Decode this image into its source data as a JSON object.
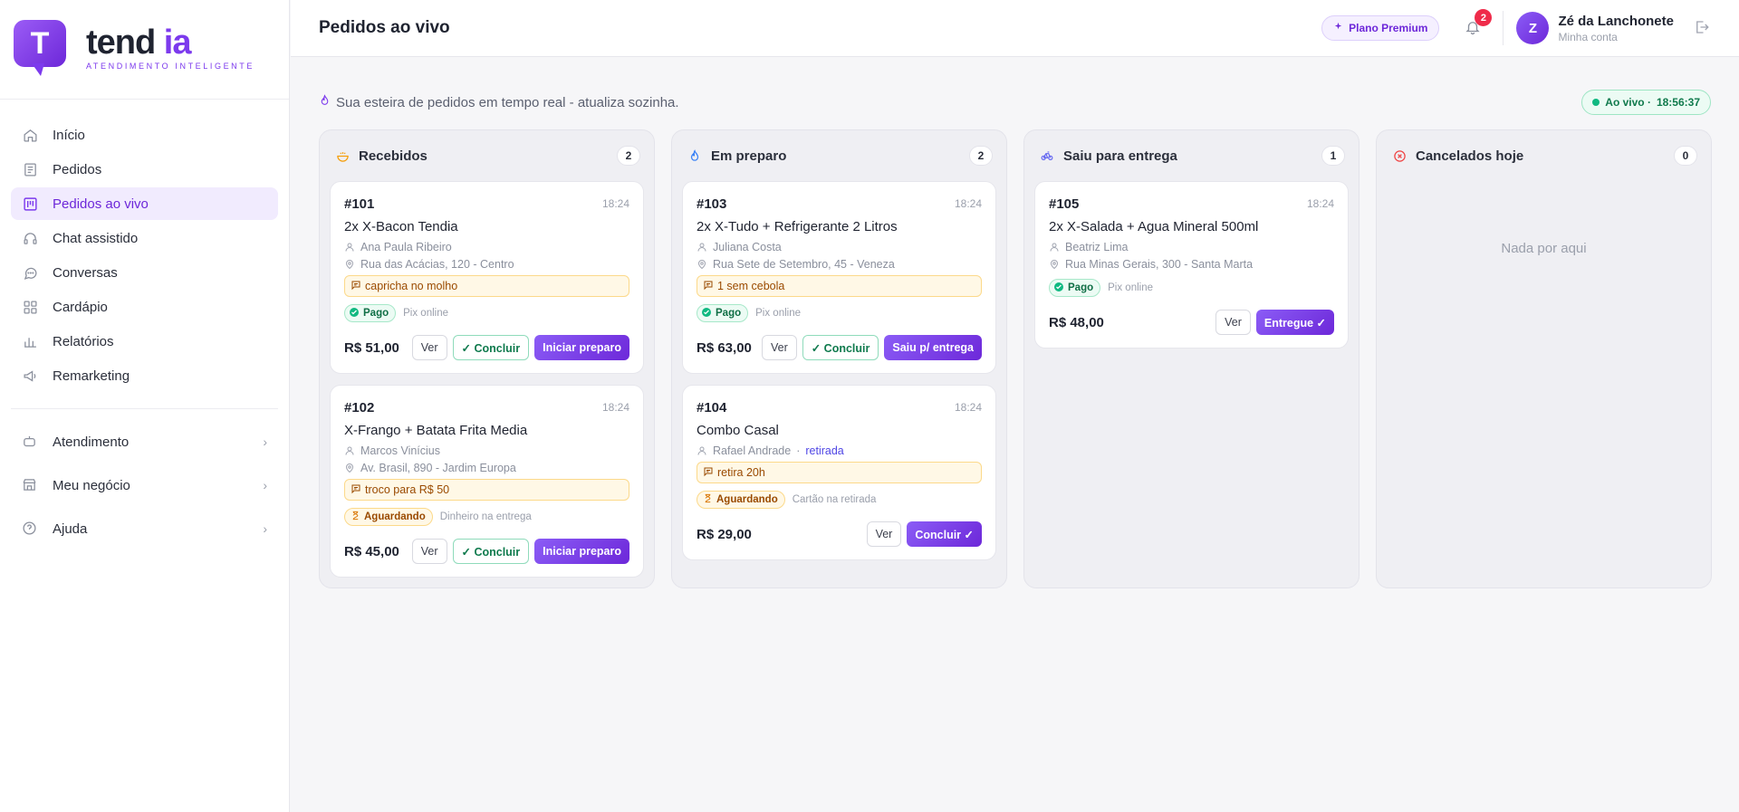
{
  "brand": {
    "logo_letter": "T",
    "name_part1": "tend",
    "name_part2": " ia",
    "tagline": "ATENDIMENTO INTELIGENTE",
    "accent": "#7c3aed"
  },
  "sidebar": {
    "items": [
      {
        "label": "Início",
        "icon": "home-icon",
        "active": false
      },
      {
        "label": "Pedidos",
        "icon": "receipt-icon",
        "active": false
      },
      {
        "label": "Pedidos ao vivo",
        "icon": "kanban-icon",
        "active": true
      },
      {
        "label": "Chat assistido",
        "icon": "headset-icon",
        "active": false
      },
      {
        "label": "Conversas",
        "icon": "chat-bubble-icon",
        "active": false
      },
      {
        "label": "Cardápio",
        "icon": "grid-icon",
        "active": false
      },
      {
        "label": "Relatórios",
        "icon": "bar-chart-icon",
        "active": false
      },
      {
        "label": "Remarketing",
        "icon": "megaphone-icon",
        "active": false
      }
    ],
    "groups": [
      {
        "label": "Atendimento",
        "icon": "bot-icon"
      },
      {
        "label": "Meu negócio",
        "icon": "store-icon"
      },
      {
        "label": "Ajuda",
        "icon": "help-circle-icon"
      }
    ]
  },
  "header": {
    "title": "Pedidos ao vivo",
    "premium_label": "Plano Premium",
    "notifications_count": "2",
    "avatar_letter": "Z",
    "user_name": "Zé da Lanchonete",
    "user_sub": "Minha conta"
  },
  "subbar": {
    "text": "Sua esteira de pedidos em tempo real - atualiza sozinha.",
    "live_label": "Ao vivo ·",
    "live_time": "18:56:37"
  },
  "columns": [
    {
      "title": "Recebidos",
      "count": "2",
      "icon": "bowl-icon",
      "icon_color": "#f59e0b"
    },
    {
      "title": "Em preparo",
      "count": "2",
      "icon": "flame-icon",
      "icon_color": "#3b82f6"
    },
    {
      "title": "Saiu para entrega",
      "count": "1",
      "icon": "bike-icon",
      "icon_color": "#6366f1"
    },
    {
      "title": "Cancelados hoje",
      "count": "0",
      "icon": "x-circle-icon",
      "icon_color": "#ef4444",
      "empty_text": "Nada por aqui"
    }
  ],
  "orders": {
    "o101": {
      "num": "#101",
      "time": "18:24",
      "title": "2x X-Bacon Tendia",
      "customer": "Ana Paula Ribeiro",
      "address": "Rua das Acácias, 120 - Centro",
      "note": "capricha no molho",
      "status": "Pago",
      "method": "Pix online",
      "price": "R$ 51,00",
      "btn_ver": "Ver",
      "btn_concluir": "✓ Concluir",
      "btn_main": "Iniciar preparo"
    },
    "o102": {
      "num": "#102",
      "time": "18:24",
      "title": "X-Frango + Batata Frita Media",
      "customer": "Marcos Vinícius",
      "address": "Av. Brasil, 890 - Jardim Europa",
      "note": "troco para R$ 50",
      "status": "Aguardando",
      "method": "Dinheiro na entrega",
      "price": "R$ 45,00",
      "btn_ver": "Ver",
      "btn_concluir": "✓ Concluir",
      "btn_main": "Iniciar preparo"
    },
    "o103": {
      "num": "#103",
      "time": "18:24",
      "title": "2x X-Tudo + Refrigerante 2 Litros",
      "customer": "Juliana Costa",
      "address": "Rua Sete de Setembro, 45 - Veneza",
      "note": "1 sem cebola",
      "status": "Pago",
      "method": "Pix online",
      "price": "R$ 63,00",
      "btn_ver": "Ver",
      "btn_concluir": "✓ Concluir",
      "btn_main": "Saiu p/ entrega"
    },
    "o104": {
      "num": "#104",
      "time": "18:24",
      "title": "Combo Casal",
      "customer": "Rafael Andrade",
      "pickup": "retirada",
      "note": "retira 20h",
      "status": "Aguardando",
      "method": "Cartão na retirada",
      "price": "R$ 29,00",
      "btn_ver": "Ver",
      "btn_main": "Concluir ✓"
    },
    "o105": {
      "num": "#105",
      "time": "18:24",
      "title": "2x X-Salada + Agua Mineral 500ml",
      "customer": "Beatriz Lima",
      "address": "Rua Minas Gerais, 300 - Santa Marta",
      "status": "Pago",
      "method": "Pix online",
      "price": "R$ 48,00",
      "btn_ver": "Ver",
      "btn_main": "Entregue ✓"
    }
  }
}
